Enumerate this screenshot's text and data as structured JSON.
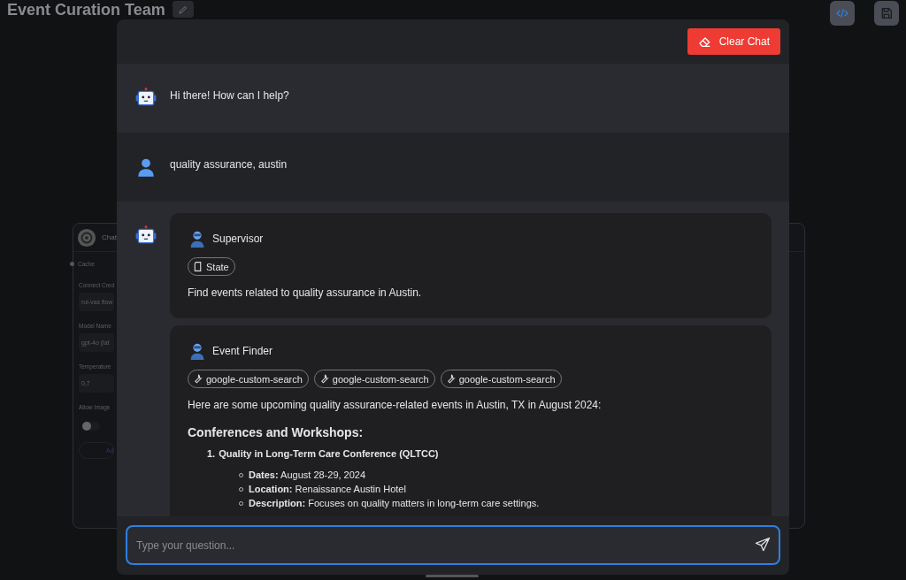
{
  "canvas": {
    "title": "Event Curation Team"
  },
  "background_node": {
    "title": "Chat",
    "fields": [
      {
        "kind": "check",
        "label": "Cache"
      },
      {
        "kind": "input",
        "label": "Connect Cred",
        "value": "rui-vas flow"
      },
      {
        "kind": "input",
        "label": "Model Name",
        "value": "gpt-4o (lat"
      },
      {
        "kind": "input",
        "label": "Temperature",
        "value": "0,7"
      },
      {
        "kind": "toggle",
        "label": "Allow Image",
        "on": false
      },
      {
        "kind": "button",
        "label": "Ad"
      }
    ]
  },
  "chat": {
    "clear_button": "Clear Chat",
    "messages": [
      {
        "kind": "bot-text",
        "text": "Hi there! How can I help?"
      },
      {
        "kind": "user-text",
        "text": "quality assurance, austin"
      },
      {
        "kind": "bot-agents",
        "agents": [
          {
            "name": "Supervisor",
            "chips": [
              {
                "kind": "state",
                "label": "State"
              }
            ],
            "blocks": [
              {
                "kind": "paragraph",
                "text": "Find events related to quality assurance in Austin."
              }
            ]
          },
          {
            "name": "Event Finder",
            "chips": [
              {
                "kind": "tool",
                "label": "google-custom-search"
              },
              {
                "kind": "tool",
                "label": "google-custom-search"
              },
              {
                "kind": "tool",
                "label": "google-custom-search"
              }
            ],
            "blocks": [
              {
                "kind": "paragraph",
                "text": "Here are some upcoming quality assurance-related events in Austin, TX in August 2024:"
              },
              {
                "kind": "heading",
                "text": "Conferences and Workshops:"
              },
              {
                "kind": "numbered",
                "number": "1.",
                "text": "Quality in Long-Term Care Conference (QLTCC)",
                "details": [
                  "**Dates:** August 28-29, 2024",
                  "**Location:** Renaissance Austin Hotel",
                  "**Description:** Focuses on quality matters in long-term care settings."
                ]
              }
            ]
          }
        ]
      }
    ],
    "input": {
      "placeholder": "Type your question..."
    }
  }
}
